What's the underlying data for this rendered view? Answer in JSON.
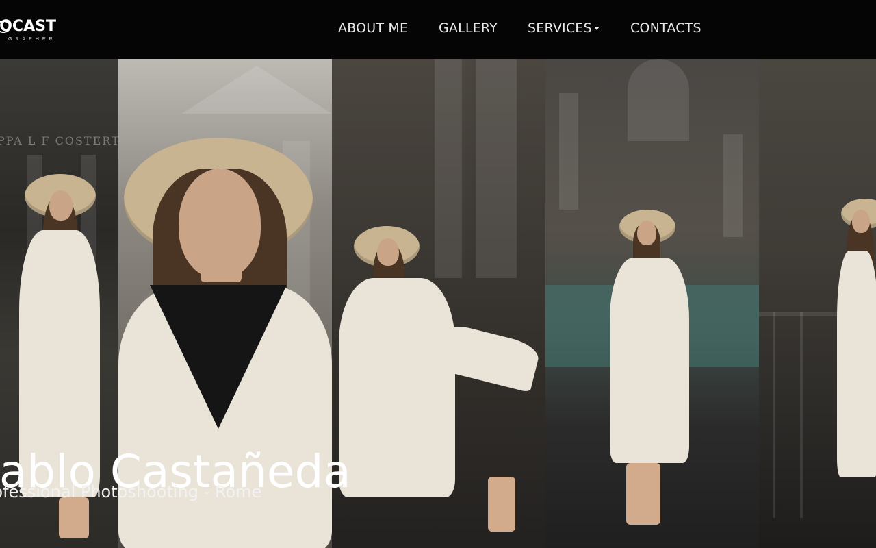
{
  "logo": {
    "text": "LOCAST",
    "subtitle": "GRAPHER"
  },
  "nav": {
    "items": [
      {
        "label": "ABOUT ME"
      },
      {
        "label": "GALLERY"
      },
      {
        "label": "SERVICES",
        "has_dropdown": true
      },
      {
        "label": "CONTACTS"
      }
    ]
  },
  "hero": {
    "title": "Pablo Castañeda",
    "subtitle": "Professional Photoshooting - Rome"
  },
  "gallery": {
    "panel_inscription": "PPA L F COSTERTI"
  },
  "colors": {
    "nav_bg": "#050505",
    "nav_text": "#e8e8e8",
    "hero_text": "#ffffff"
  }
}
